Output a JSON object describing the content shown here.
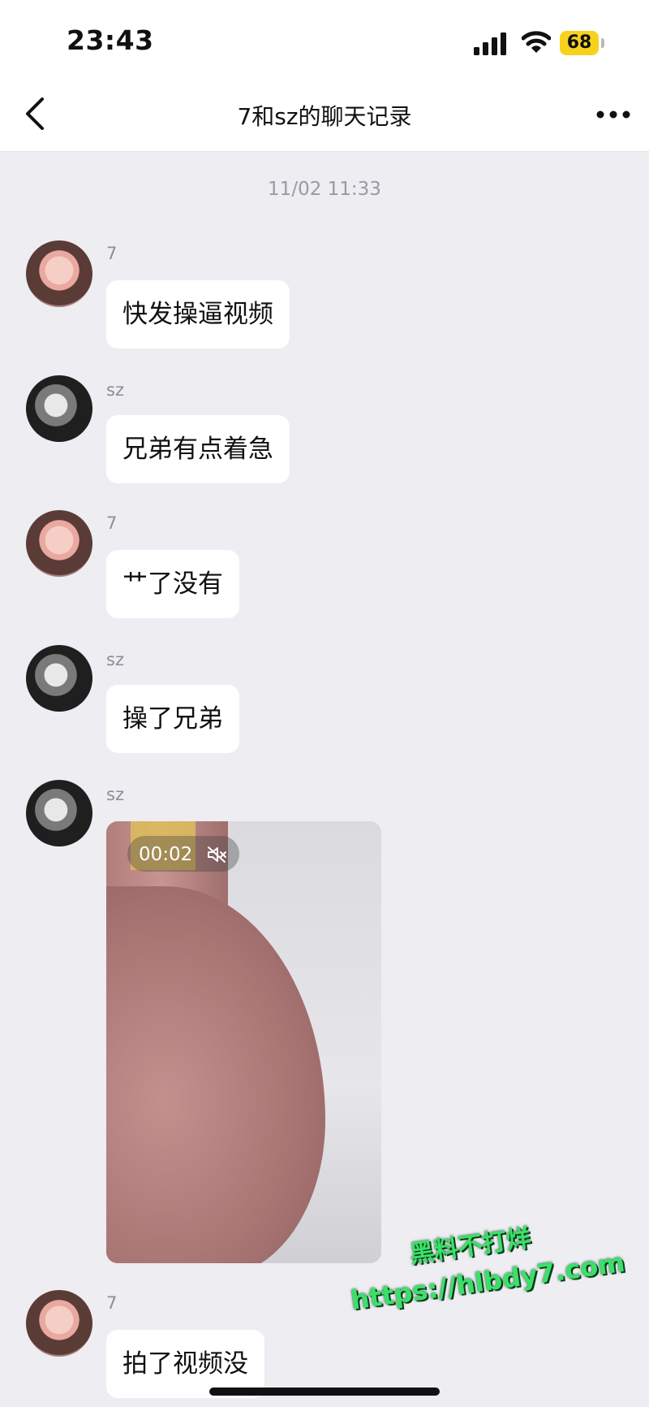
{
  "status_bar": {
    "time": "23:43",
    "battery": "68",
    "battery_color": "#f6d21f"
  },
  "header": {
    "title": "7和sz的聊天记录",
    "back_icon": "chevron-left-icon",
    "more_icon": "more-horizontal-icon"
  },
  "timestamp": "11/02 11:33",
  "messages": [
    {
      "sender": "7",
      "text": "快发操逼视频"
    },
    {
      "sender": "sz",
      "text": "兄弟有点着急"
    },
    {
      "sender": "7",
      "text": "艹了没有"
    },
    {
      "sender": "sz",
      "text": "操了兄弟"
    },
    {
      "sender": "sz",
      "video_duration": "00:02",
      "video_muted": true
    },
    {
      "sender": "7",
      "text": "拍了视频没"
    }
  ],
  "watermark": {
    "line1": "黑料不打烊",
    "line2": "https://hlbdy7.com",
    "color": "#3be06a"
  }
}
